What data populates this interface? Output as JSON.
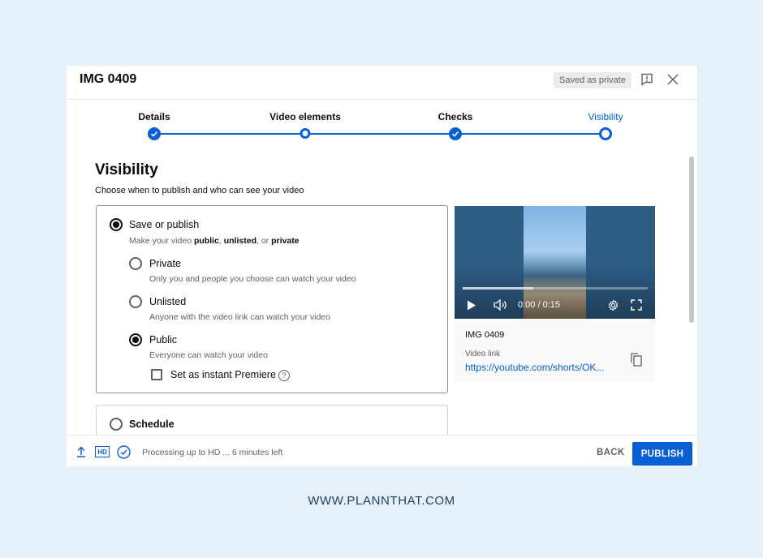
{
  "header": {
    "title": "IMG 0409",
    "status_badge": "Saved as private",
    "icons": [
      "feedback-icon",
      "close-icon"
    ]
  },
  "stepper": {
    "steps": [
      {
        "label": "Details",
        "state": "done"
      },
      {
        "label": "Video elements",
        "state": "visited"
      },
      {
        "label": "Checks",
        "state": "done"
      },
      {
        "label": "Visibility",
        "state": "current"
      }
    ]
  },
  "main": {
    "heading": "Visibility",
    "subheading": "Choose when to publish and who can see your video",
    "save_or_publish": {
      "label": "Save or publish",
      "desc_prefix": "Make your video ",
      "desc_public": "public",
      "desc_sep1": ", ",
      "desc_unlisted": "unlisted",
      "desc_sep2": ", or ",
      "desc_private": "private",
      "selected": true
    },
    "options": [
      {
        "label": "Private",
        "desc": "Only you and people you choose can watch your video",
        "selected": false
      },
      {
        "label": "Unlisted",
        "desc": "Anyone with the video link can watch your video",
        "selected": false
      },
      {
        "label": "Public",
        "desc": "Everyone can watch your video",
        "selected": true
      }
    ],
    "premiere": {
      "label": "Set as instant Premiere",
      "checked": false,
      "help": "?"
    },
    "schedule": {
      "label": "Schedule",
      "selected": false
    }
  },
  "preview": {
    "time": "0:00 / 0:15",
    "progress": 0.38,
    "name": "IMG 0409",
    "link_label": "Video link",
    "link": "https://youtube.com/shorts/OK..."
  },
  "footer": {
    "status": "Processing up to HD ... 6 minutes left",
    "hd_badge": "HD",
    "back_label": "BACK",
    "publish_label": "PUBLISH"
  },
  "caption": "WWW.PLANNTHAT.COM",
  "colors": {
    "accent": "#065fd4",
    "background": "#e6f0fb"
  }
}
